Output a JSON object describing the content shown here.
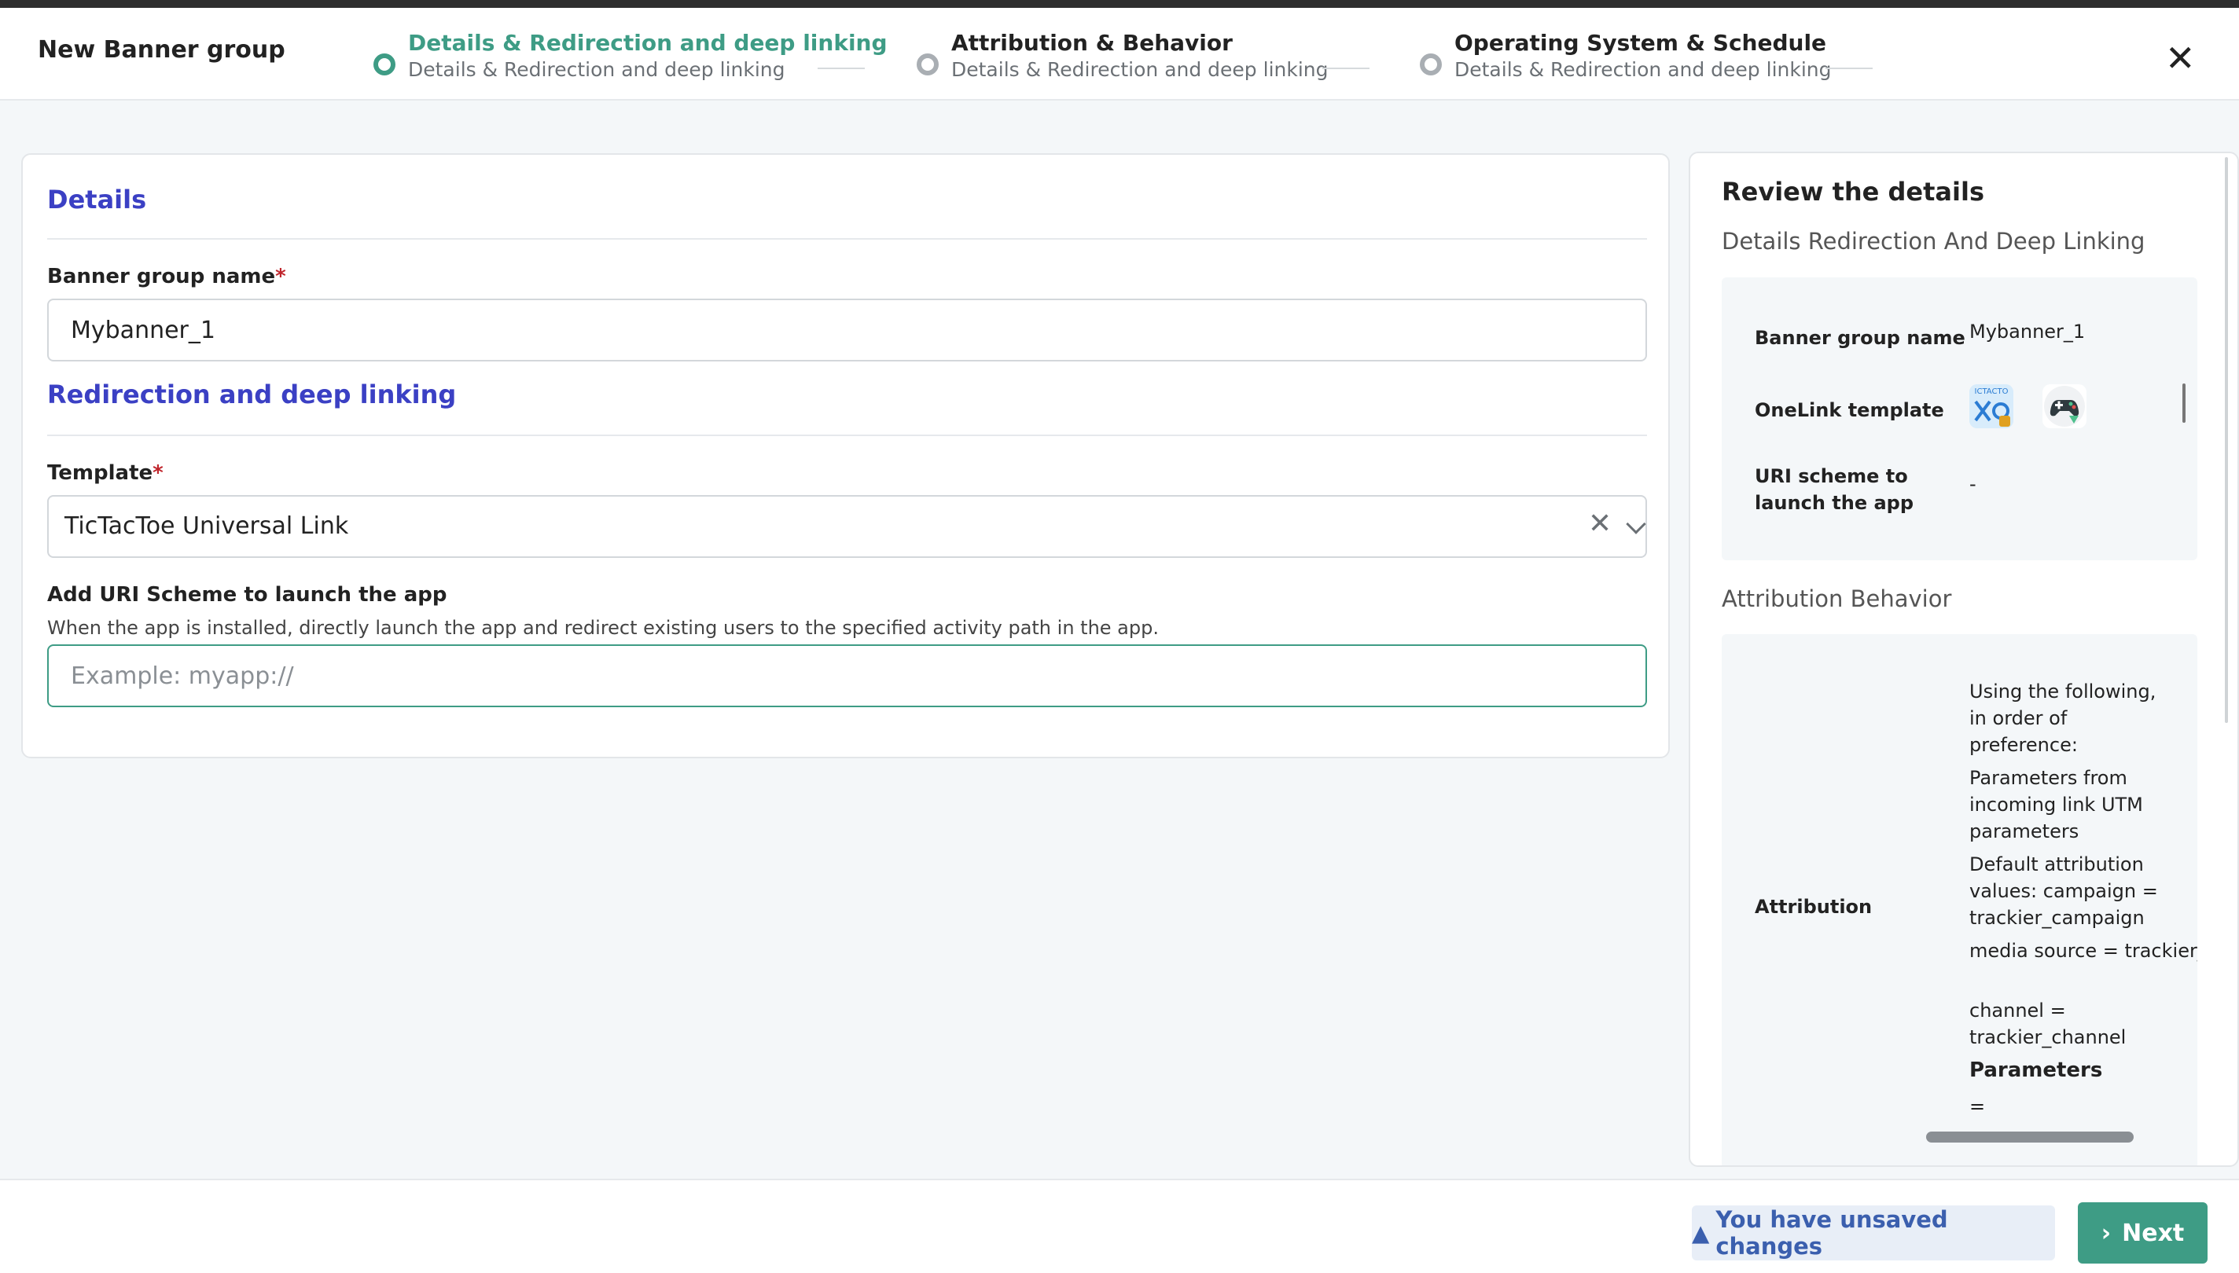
{
  "header": {
    "title": "New Banner group",
    "close_symbol": "✕",
    "steps": [
      {
        "title": "Details & Redirection and deep linking",
        "subtitle": "Details & Redirection and deep linking"
      },
      {
        "title": "Attribution & Behavior",
        "subtitle": "Details & Redirection and deep linking"
      },
      {
        "title": "Operating System & Schedule",
        "subtitle": "Details & Redirection and deep linking"
      }
    ]
  },
  "form": {
    "details_title": "Details",
    "banner_name_label": "Banner group name",
    "required_mark": "*",
    "banner_name_value": "Mybanner_1",
    "redirection_title": "Redirection and deep linking",
    "template_label": "Template",
    "template_value": "TicTacToe Universal Link",
    "uri_label": "Add URI Scheme to launch the app",
    "uri_help": "When the app is installed, directly launch the app and redirect existing users to the specified activity path in the app.",
    "uri_placeholder": "Example: myapp://"
  },
  "review": {
    "title": "Review the details",
    "section1": "Details Redirection And Deep Linking",
    "rows1": [
      {
        "label": "Banner group name",
        "value": "Mybanner_1"
      },
      {
        "label": "OneLink template",
        "value": ""
      },
      {
        "label": "URI scheme to launch the app",
        "value": "-"
      }
    ],
    "thumb1_text": "ICTACTO",
    "section2": "Attribution Behavior",
    "attribution_label": "Attribution",
    "attribution_lines": [
      "Using the following, in order of preference:",
      "Parameters from incoming link UTM parameters",
      "Default attribution values: campaign = trackier_campaign",
      "media source = trackier_media_source",
      "channel = trackier_channel"
    ],
    "parameters_label": "Parameters",
    "parameters_value": "="
  },
  "footer": {
    "unsaved_icon": "▲",
    "unsaved_text": "You have unsaved changes",
    "next_icon": "›",
    "next_label": "Next"
  },
  "colors": {
    "accent": "#3e9c85",
    "section_title": "#3b40c4",
    "required": "#c0262d",
    "unsaved_bg": "#e8eef7",
    "unsaved_text": "#3b5fae"
  }
}
